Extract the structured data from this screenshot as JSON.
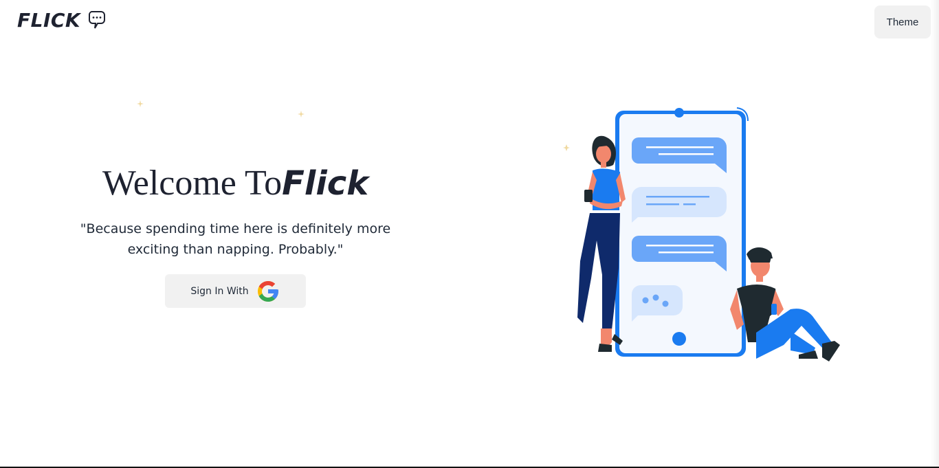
{
  "header": {
    "brand": "FLICK",
    "logo_icon": "chat-bubble-icon",
    "theme_button_label": "Theme"
  },
  "hero": {
    "welcome_prefix": "Welcome To",
    "welcome_brand": "Flick",
    "tagline": "\"Because spending time here is definitely more exciting than napping. Probably.\"",
    "signin_label": "Sign In With",
    "signin_icon": "google-icon"
  },
  "illustration": {
    "subject": "chat-illustration",
    "colors": {
      "primary_blue": "#1a7bf0",
      "light_blue": "#6aa6f8",
      "pale_blue": "#d6e6fd",
      "navy": "#0f2a6b",
      "dark": "#1f2a30",
      "skin": "#f2876d"
    }
  },
  "colors": {
    "text": "#1e2230",
    "button_bg": "#f1f1f1",
    "google_blue": "#4285F4",
    "google_red": "#EA4335",
    "google_yellow": "#FBBC05",
    "google_green": "#34A853"
  }
}
